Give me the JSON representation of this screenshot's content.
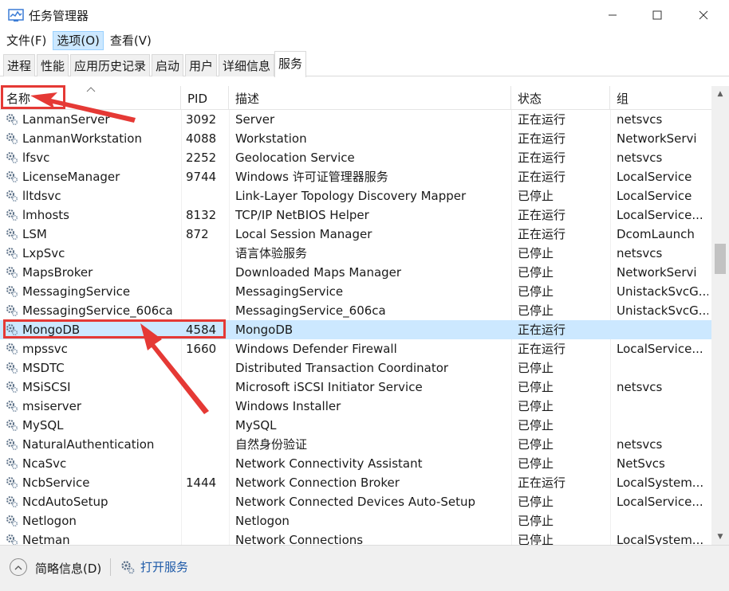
{
  "window": {
    "title": "任务管理器"
  },
  "menu": [
    {
      "label": "文件(F)",
      "active": false
    },
    {
      "label": "选项(O)",
      "active": true
    },
    {
      "label": "查看(V)",
      "active": false
    }
  ],
  "tabs": [
    {
      "label": "进程"
    },
    {
      "label": "性能"
    },
    {
      "label": "应用历史记录"
    },
    {
      "label": "启动"
    },
    {
      "label": "用户"
    },
    {
      "label": "详细信息"
    },
    {
      "label": "服务"
    }
  ],
  "active_tab": "服务",
  "columns": {
    "name": "名称",
    "pid": "PID",
    "desc": "描述",
    "status": "状态",
    "group": "组"
  },
  "rows": [
    {
      "name": "LanmanServer",
      "pid": "3092",
      "desc": "Server",
      "status": "正在运行",
      "group": "netsvcs"
    },
    {
      "name": "LanmanWorkstation",
      "pid": "4088",
      "desc": "Workstation",
      "status": "正在运行",
      "group": "NetworkServi"
    },
    {
      "name": "lfsvc",
      "pid": "2252",
      "desc": "Geolocation Service",
      "status": "正在运行",
      "group": "netsvcs"
    },
    {
      "name": "LicenseManager",
      "pid": "9744",
      "desc": "Windows 许可证管理器服务",
      "status": "正在运行",
      "group": "LocalService"
    },
    {
      "name": "lltdsvc",
      "pid": "",
      "desc": "Link-Layer Topology Discovery Mapper",
      "status": "已停止",
      "group": "LocalService"
    },
    {
      "name": "lmhosts",
      "pid": "8132",
      "desc": "TCP/IP NetBIOS Helper",
      "status": "正在运行",
      "group": "LocalService..."
    },
    {
      "name": "LSM",
      "pid": "872",
      "desc": "Local Session Manager",
      "status": "正在运行",
      "group": "DcomLaunch"
    },
    {
      "name": "LxpSvc",
      "pid": "",
      "desc": "语言体验服务",
      "status": "已停止",
      "group": "netsvcs"
    },
    {
      "name": "MapsBroker",
      "pid": "",
      "desc": "Downloaded Maps Manager",
      "status": "已停止",
      "group": "NetworkServi"
    },
    {
      "name": "MessagingService",
      "pid": "",
      "desc": "MessagingService",
      "status": "已停止",
      "group": "UnistackSvcG..."
    },
    {
      "name": "MessagingService_606ca",
      "pid": "",
      "desc": "MessagingService_606ca",
      "status": "已停止",
      "group": "UnistackSvcG..."
    },
    {
      "name": "MongoDB",
      "pid": "4584",
      "desc": "MongoDB",
      "status": "正在运行",
      "group": "",
      "selected": true
    },
    {
      "name": "mpssvc",
      "pid": "1660",
      "desc": "Windows Defender Firewall",
      "status": "正在运行",
      "group": "LocalService..."
    },
    {
      "name": "MSDTC",
      "pid": "",
      "desc": "Distributed Transaction Coordinator",
      "status": "已停止",
      "group": ""
    },
    {
      "name": "MSiSCSI",
      "pid": "",
      "desc": "Microsoft iSCSI Initiator Service",
      "status": "已停止",
      "group": "netsvcs"
    },
    {
      "name": "msiserver",
      "pid": "",
      "desc": "Windows Installer",
      "status": "已停止",
      "group": ""
    },
    {
      "name": "MySQL",
      "pid": "",
      "desc": "MySQL",
      "status": "已停止",
      "group": ""
    },
    {
      "name": "NaturalAuthentication",
      "pid": "",
      "desc": "自然身份验证",
      "status": "已停止",
      "group": "netsvcs"
    },
    {
      "name": "NcaSvc",
      "pid": "",
      "desc": "Network Connectivity Assistant",
      "status": "已停止",
      "group": "NetSvcs"
    },
    {
      "name": "NcbService",
      "pid": "1444",
      "desc": "Network Connection Broker",
      "status": "正在运行",
      "group": "LocalSystem..."
    },
    {
      "name": "NcdAutoSetup",
      "pid": "",
      "desc": "Network Connected Devices Auto-Setup",
      "status": "已停止",
      "group": "LocalService..."
    },
    {
      "name": "Netlogon",
      "pid": "",
      "desc": "Netlogon",
      "status": "已停止",
      "group": ""
    },
    {
      "name": "Netman",
      "pid": "",
      "desc": "Network Connections",
      "status": "已停止",
      "group": "LocalSystem..."
    }
  ],
  "footer": {
    "collapse_label": "简略信息(D)",
    "open_services_label": "打开服务"
  },
  "colors": {
    "selection": "#cce8ff",
    "annotation": "#e53935",
    "link": "#1e5aa8"
  }
}
